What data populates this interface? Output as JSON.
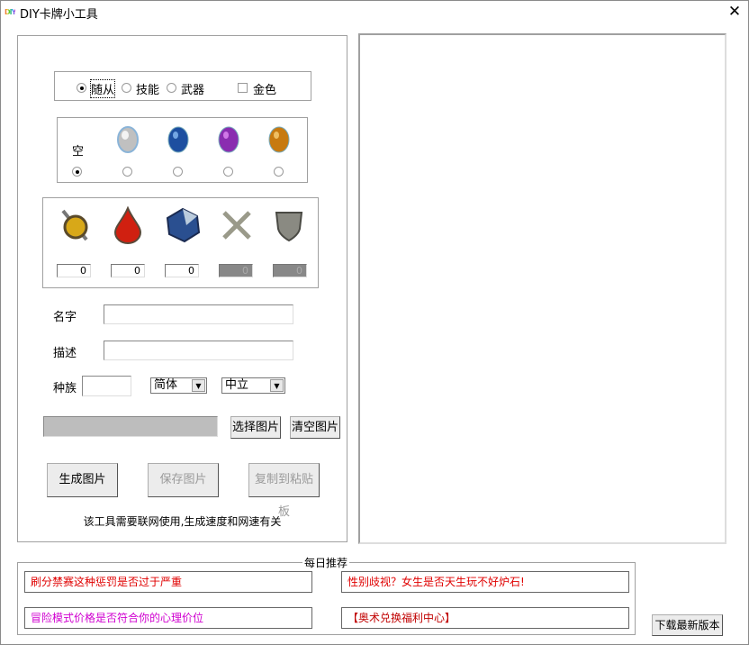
{
  "window": {
    "logo": "DIY",
    "title": "DIY卡牌小工具",
    "close": "✕"
  },
  "card_type": {
    "options": [
      "随从",
      "技能",
      "武器"
    ],
    "selected": "随从",
    "golden_label": "金色",
    "golden_checked": false
  },
  "rarity": {
    "empty_label": "空",
    "options": [
      "empty",
      "common",
      "rare",
      "epic",
      "legendary"
    ],
    "selected": "empty",
    "colors": [
      "#b8b8b8",
      "#1d4fa0",
      "#8a2db0",
      "#c77a10"
    ]
  },
  "stats": [
    {
      "icon": "mana-icon",
      "value": "0",
      "enabled": true
    },
    {
      "icon": "health-icon",
      "value": "0",
      "enabled": true
    },
    {
      "icon": "crystal-icon",
      "value": "0",
      "enabled": true
    },
    {
      "icon": "attack-icon",
      "value": "0",
      "enabled": false
    },
    {
      "icon": "armor-icon",
      "value": "0",
      "enabled": false
    }
  ],
  "form": {
    "name_label": "名字",
    "name_value": "",
    "desc_label": "描述",
    "desc_value": "",
    "race_label": "种族",
    "race_value": "",
    "language": "简体",
    "faction": "中立"
  },
  "image": {
    "path": "",
    "select_button": "选择图片",
    "clear_button": "清空图片"
  },
  "actions": {
    "generate": "生成图片",
    "save": "保存图片",
    "copy": "复制到粘贴板"
  },
  "note": "该工具需要联网使用,生成速度和网速有关",
  "daily": {
    "title": "每日推荐",
    "items": [
      {
        "text": "刷分禁赛这种惩罚是否过于严重",
        "color": "#e00000"
      },
      {
        "text": "性别歧视？女生是否天生玩不好炉石!",
        "color": "#e00000"
      },
      {
        "text": "冒险模式价格是否符合你的心理价位",
        "color": "#d000d0"
      },
      {
        "text": "【奥术兑换福利中心】",
        "color": "#c00000"
      }
    ]
  },
  "download_button": "下载最新版本"
}
